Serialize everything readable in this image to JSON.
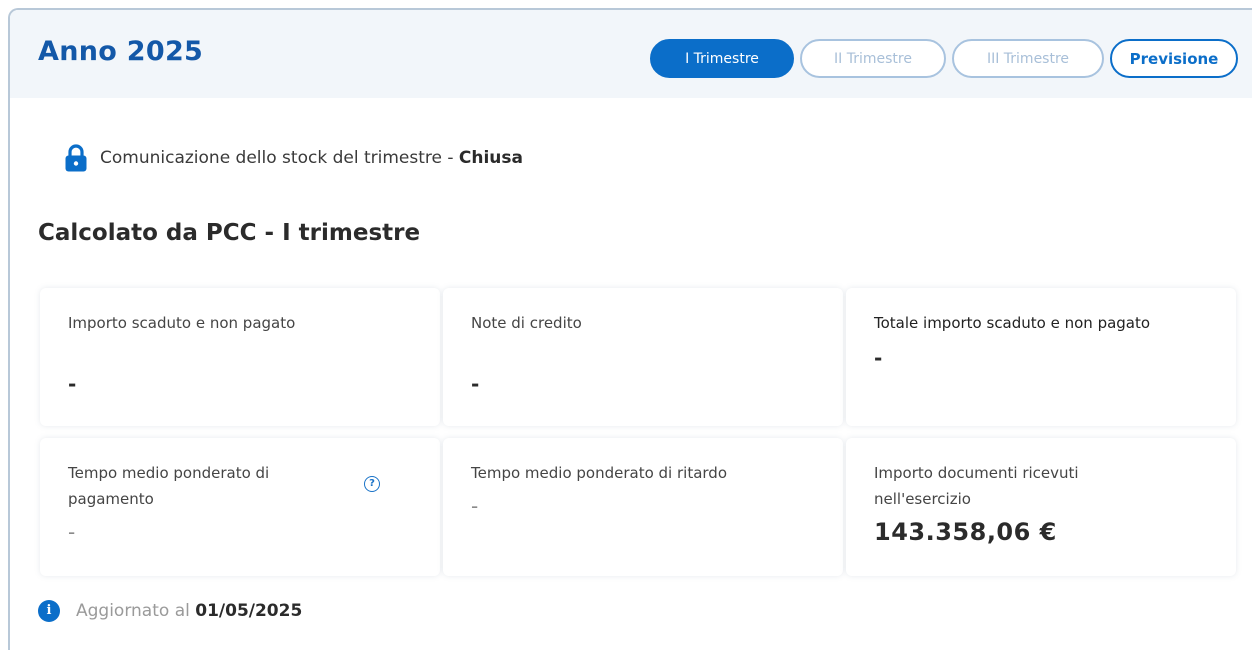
{
  "header": {
    "title": "Anno 2025",
    "tabs": [
      {
        "label": "I Trimestre"
      },
      {
        "label": "II Trimestre"
      },
      {
        "label": "III Trimestre"
      },
      {
        "label": "Previsione"
      }
    ]
  },
  "communication": {
    "icon": "lock-icon",
    "text": "Comunicazione dello stock del trimestre -",
    "status": "Chiusa"
  },
  "section": {
    "title": "Calcolato da PCC - I trimestre"
  },
  "cards": [
    {
      "label": "Importo scaduto e non pagato",
      "value": "-"
    },
    {
      "label": "Note di credito",
      "value": "-"
    },
    {
      "label": "Totale importo scaduto e non pagato",
      "value": "-"
    },
    {
      "label": "Tempo medio ponderato di pagamento",
      "value": "-",
      "help_icon": "?"
    },
    {
      "label": "Tempo medio ponderato di ritardo",
      "value": "-"
    },
    {
      "label": "Importo documenti ricevuti nell'esercizio",
      "value": "143.358,06 €"
    }
  ],
  "footer": {
    "icon": "info-icon",
    "icon_glyph": "i",
    "text": "Aggiornato al",
    "date": "01/05/2025"
  },
  "colors": {
    "primary": "#0b6ec9",
    "title": "#1358a8",
    "header_bg": "#f2f6fa"
  }
}
